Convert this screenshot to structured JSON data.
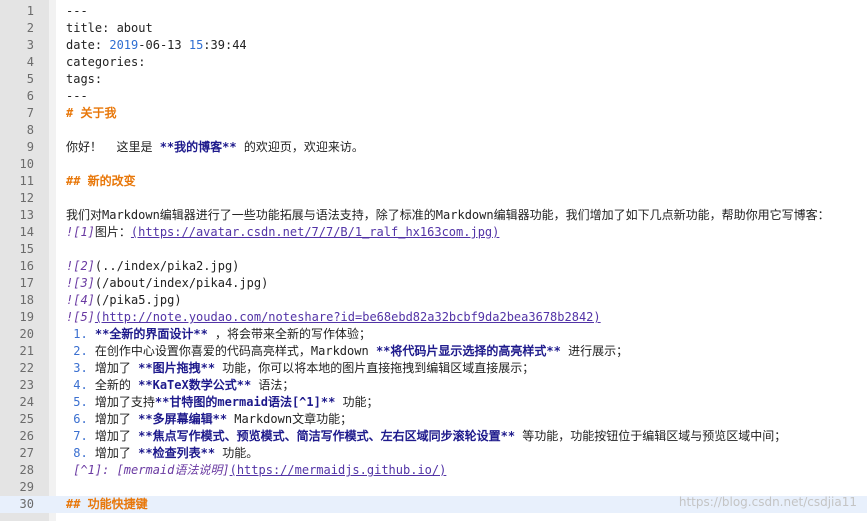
{
  "editor": {
    "lines": [
      {
        "n": "1",
        "t": "---"
      },
      {
        "n": "2",
        "t": "title: about"
      },
      {
        "n": "3",
        "a": "date: ",
        "b": "2019",
        "c": "-06-13 ",
        "d": "15",
        "e": ":39:44"
      },
      {
        "n": "4",
        "t": "categories:"
      },
      {
        "n": "5",
        "t": "tags:"
      },
      {
        "n": "6",
        "t": "---"
      },
      {
        "n": "7",
        "h": "# 关于我"
      },
      {
        "n": "8"
      },
      {
        "n": "9",
        "a": "你好！  这里是 ",
        "b": "**我的博客**",
        "c": " 的欢迎页，欢迎来访。"
      },
      {
        "n": "10"
      },
      {
        "n": "11",
        "h": "## 新的改变"
      },
      {
        "n": "12"
      },
      {
        "n": "13",
        "t": "我们对Markdown编辑器进行了一些功能拓展与语法支持，除了标准的Markdown编辑器功能，我们增加了如下几点新功能，帮助你用它写博客："
      },
      {
        "n": "14",
        "a": "图片：",
        "img": "![1]",
        "u": "(https://avatar.csdn.net/7/7/B/1_ralf_hx163com.jpg)"
      },
      {
        "n": "15"
      },
      {
        "n": "16",
        "img": "![2]",
        "r": "(../index/pika2.jpg)"
      },
      {
        "n": "17",
        "img": "![3]",
        "r": "(/about/index/pika4.jpg)"
      },
      {
        "n": "18",
        "img": "![4]",
        "r": "(/pika5.jpg)"
      },
      {
        "n": "19",
        "img": "![5]",
        "u": "(http://note.youdao.com/noteshare?id=be68ebd82a32bcbf9da2bea3678b2842)"
      },
      {
        "n": "20",
        "li": " 1. ",
        "b": "**全新的界面设计**",
        "c": " ，将会带来全新的写作体验；"
      },
      {
        "n": "21",
        "li": " 2. ",
        "a": "在创作中心设置你喜爱的代码高亮样式，Markdown ",
        "b": "**将代码片显示选择的高亮样式**",
        "c": " 进行展示；"
      },
      {
        "n": "22",
        "li": " 3. ",
        "a": "增加了 ",
        "b": "**图片拖拽**",
        "c": " 功能，你可以将本地的图片直接拖拽到编辑区域直接展示；"
      },
      {
        "n": "23",
        "li": " 4. ",
        "a": "全新的 ",
        "b": "**KaTeX数学公式**",
        "c": " 语法；"
      },
      {
        "n": "24",
        "li": " 5. ",
        "a": "增加了支持",
        "b": "**甘特图的mermaid语法[^1]**",
        "c": " 功能；"
      },
      {
        "n": "25",
        "li": " 6. ",
        "a": "增加了 ",
        "b": "**多屏幕编辑**",
        "c": " Markdown文章功能；"
      },
      {
        "n": "26",
        "li": " 7. ",
        "a": "增加了 ",
        "b": "**焦点写作模式、预览模式、简洁写作模式、左右区域同步滚轮设置**",
        "c": " 等功能，功能按钮位于编辑区域与预览区域中间；"
      },
      {
        "n": "27",
        "li": " 8. ",
        "a": "增加了 ",
        "b": "**检查列表**",
        "c": " 功能。"
      },
      {
        "n": "28",
        "img": " [^1]: [mermaid语法说明]",
        "u": "(https://mermaidjs.github.io/)"
      },
      {
        "n": "29"
      },
      {
        "n": "30",
        "h": "## 功能快捷键",
        "cur": true
      }
    ]
  },
  "watermark": "https://blog.csdn.net/csdjia11"
}
